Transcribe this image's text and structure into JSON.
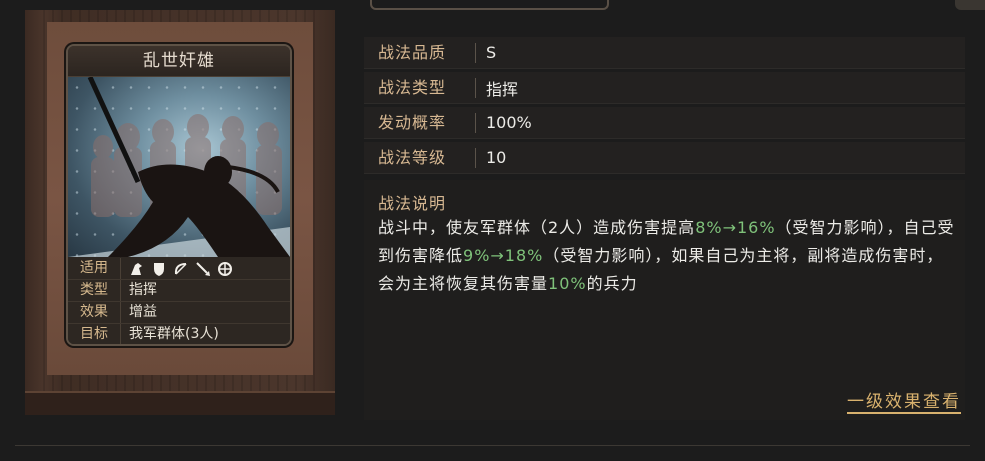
{
  "card": {
    "title": "乱世奸雄",
    "stats": [
      {
        "label": "适用",
        "value": ""
      },
      {
        "label": "类型",
        "value": "指挥"
      },
      {
        "label": "效果",
        "value": "增益"
      },
      {
        "label": "目标",
        "value": "我军群体(3人)"
      }
    ],
    "arms_icons": [
      "cavalry-icon",
      "shield-icon",
      "bow-icon",
      "spear-icon",
      "wheel-icon"
    ]
  },
  "info": {
    "quality_label": "战法品质",
    "quality_value": "S",
    "type_label": "战法类型",
    "type_value": "指挥",
    "rate_label": "发动概率",
    "rate_value": "100%",
    "level_label": "战法等级",
    "level_value": "10"
  },
  "description": {
    "title": "战法说明",
    "parts": [
      {
        "text": "战斗中，使友军群体（2人）造成伤害提高",
        "highlight": false
      },
      {
        "text": "8%→16%",
        "highlight": true
      },
      {
        "text": "（受智力影响），自己受到伤害降低",
        "highlight": false
      },
      {
        "text": "9%→18%",
        "highlight": true
      },
      {
        "text": "（受智力影响），如果自己为主将，副将造成伤害时，会为主将恢复其伤害量",
        "highlight": false
      },
      {
        "text": "10%",
        "highlight": true
      },
      {
        "text": "的兵力",
        "highlight": false
      }
    ]
  },
  "effect_link": "一级效果查看",
  "colors": {
    "label": "#d7b892",
    "highlight": "#7fc27a",
    "link": "#d9b26e"
  }
}
